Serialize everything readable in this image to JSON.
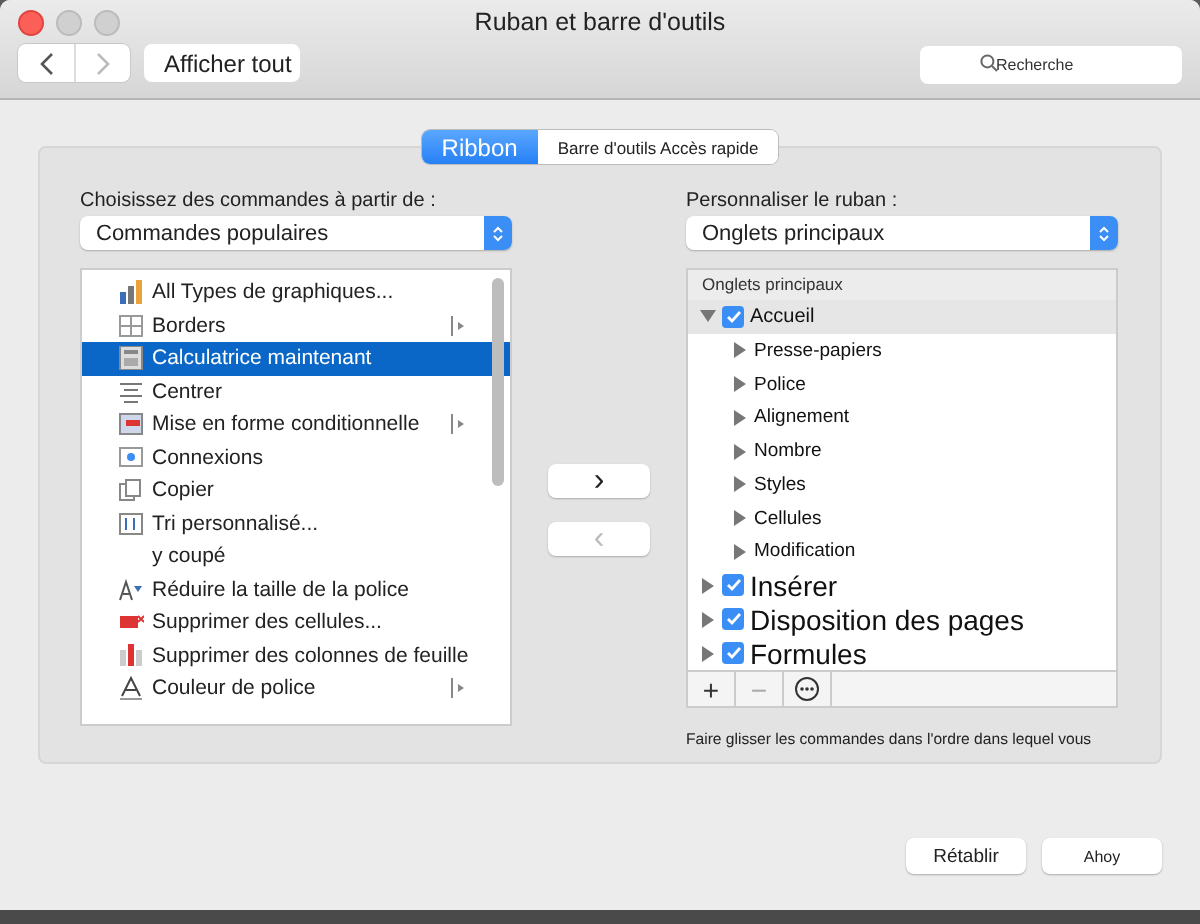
{
  "window": {
    "title": "Ruban et barre d'outils"
  },
  "toolbar": {
    "show_all": "Afficher tout",
    "search": {
      "placeholder": "Recherche"
    }
  },
  "tabs": [
    {
      "label": "Ribbon",
      "selected": true
    },
    {
      "label": "Barre d'outils Accès rapide",
      "selected": false
    }
  ],
  "commands": {
    "label": "Choisissez des commandes à partir de :",
    "select": "Commandes populaires",
    "items": [
      {
        "kind": "chart",
        "label": "All Types de graphiques...",
        "selected": false,
        "submenu": false
      },
      {
        "kind": "borders",
        "label": "Borders",
        "selected": false,
        "submenu": true
      },
      {
        "kind": "calculator",
        "label": "Calculatrice maintenant",
        "selected": true,
        "submenu": false
      },
      {
        "kind": "center",
        "label": "Centrer",
        "selected": false,
        "submenu": false
      },
      {
        "kind": "conditional",
        "label": "Mise en forme conditionnelle",
        "selected": false,
        "submenu": true
      },
      {
        "kind": "connections",
        "label": "Connexions",
        "selected": false,
        "submenu": false
      },
      {
        "kind": "copy",
        "label": "Copier",
        "selected": false,
        "submenu": false
      },
      {
        "kind": "sort",
        "label": "Tri personnalisé...",
        "selected": false,
        "submenu": false
      },
      {
        "kind": "plain",
        "label": "y coupé",
        "selected": false,
        "submenu": false
      },
      {
        "kind": "shrink",
        "label": "Réduire la taille de la police",
        "selected": false,
        "submenu": false
      },
      {
        "kind": "delcells",
        "label": "Supprimer des cellules...",
        "selected": false,
        "submenu": false
      },
      {
        "kind": "delcols",
        "label": "Supprimer des colonnes de feuille",
        "selected": false,
        "submenu": false
      },
      {
        "kind": "fontcolor",
        "label": "Couleur de police",
        "selected": false,
        "submenu": true
      }
    ]
  },
  "move_buttons": [
    {
      "label": "›",
      "disabled": false
    },
    {
      "label": "‹",
      "disabled": true
    }
  ],
  "ribbon": {
    "label": "Personnaliser le ruban :",
    "select": "Onglets principaux",
    "header": "Onglets principaux",
    "tabs": [
      {
        "label": "Accueil",
        "checked": true,
        "expanded": true,
        "selected": true,
        "children": [
          {
            "label": "Presse-papiers"
          },
          {
            "label": "Police"
          },
          {
            "label": "Alignement"
          },
          {
            "label": "Nombre"
          },
          {
            "label": "Styles"
          },
          {
            "label": "Cellules"
          },
          {
            "label": "Modification"
          }
        ]
      },
      {
        "label": "Insérer",
        "checked": true,
        "expanded": false,
        "selected": false
      },
      {
        "label": "Disposition des pages",
        "checked": true,
        "expanded": false,
        "selected": false
      },
      {
        "label": "Formules",
        "checked": true,
        "expanded": false,
        "selected": false
      }
    ],
    "tools": [
      "+",
      "−"
    ],
    "hint": "Faire glisser les commandes dans l'ordre dans lequel vous"
  },
  "footer_buttons": [
    "Rétablir",
    "Ahoy"
  ]
}
